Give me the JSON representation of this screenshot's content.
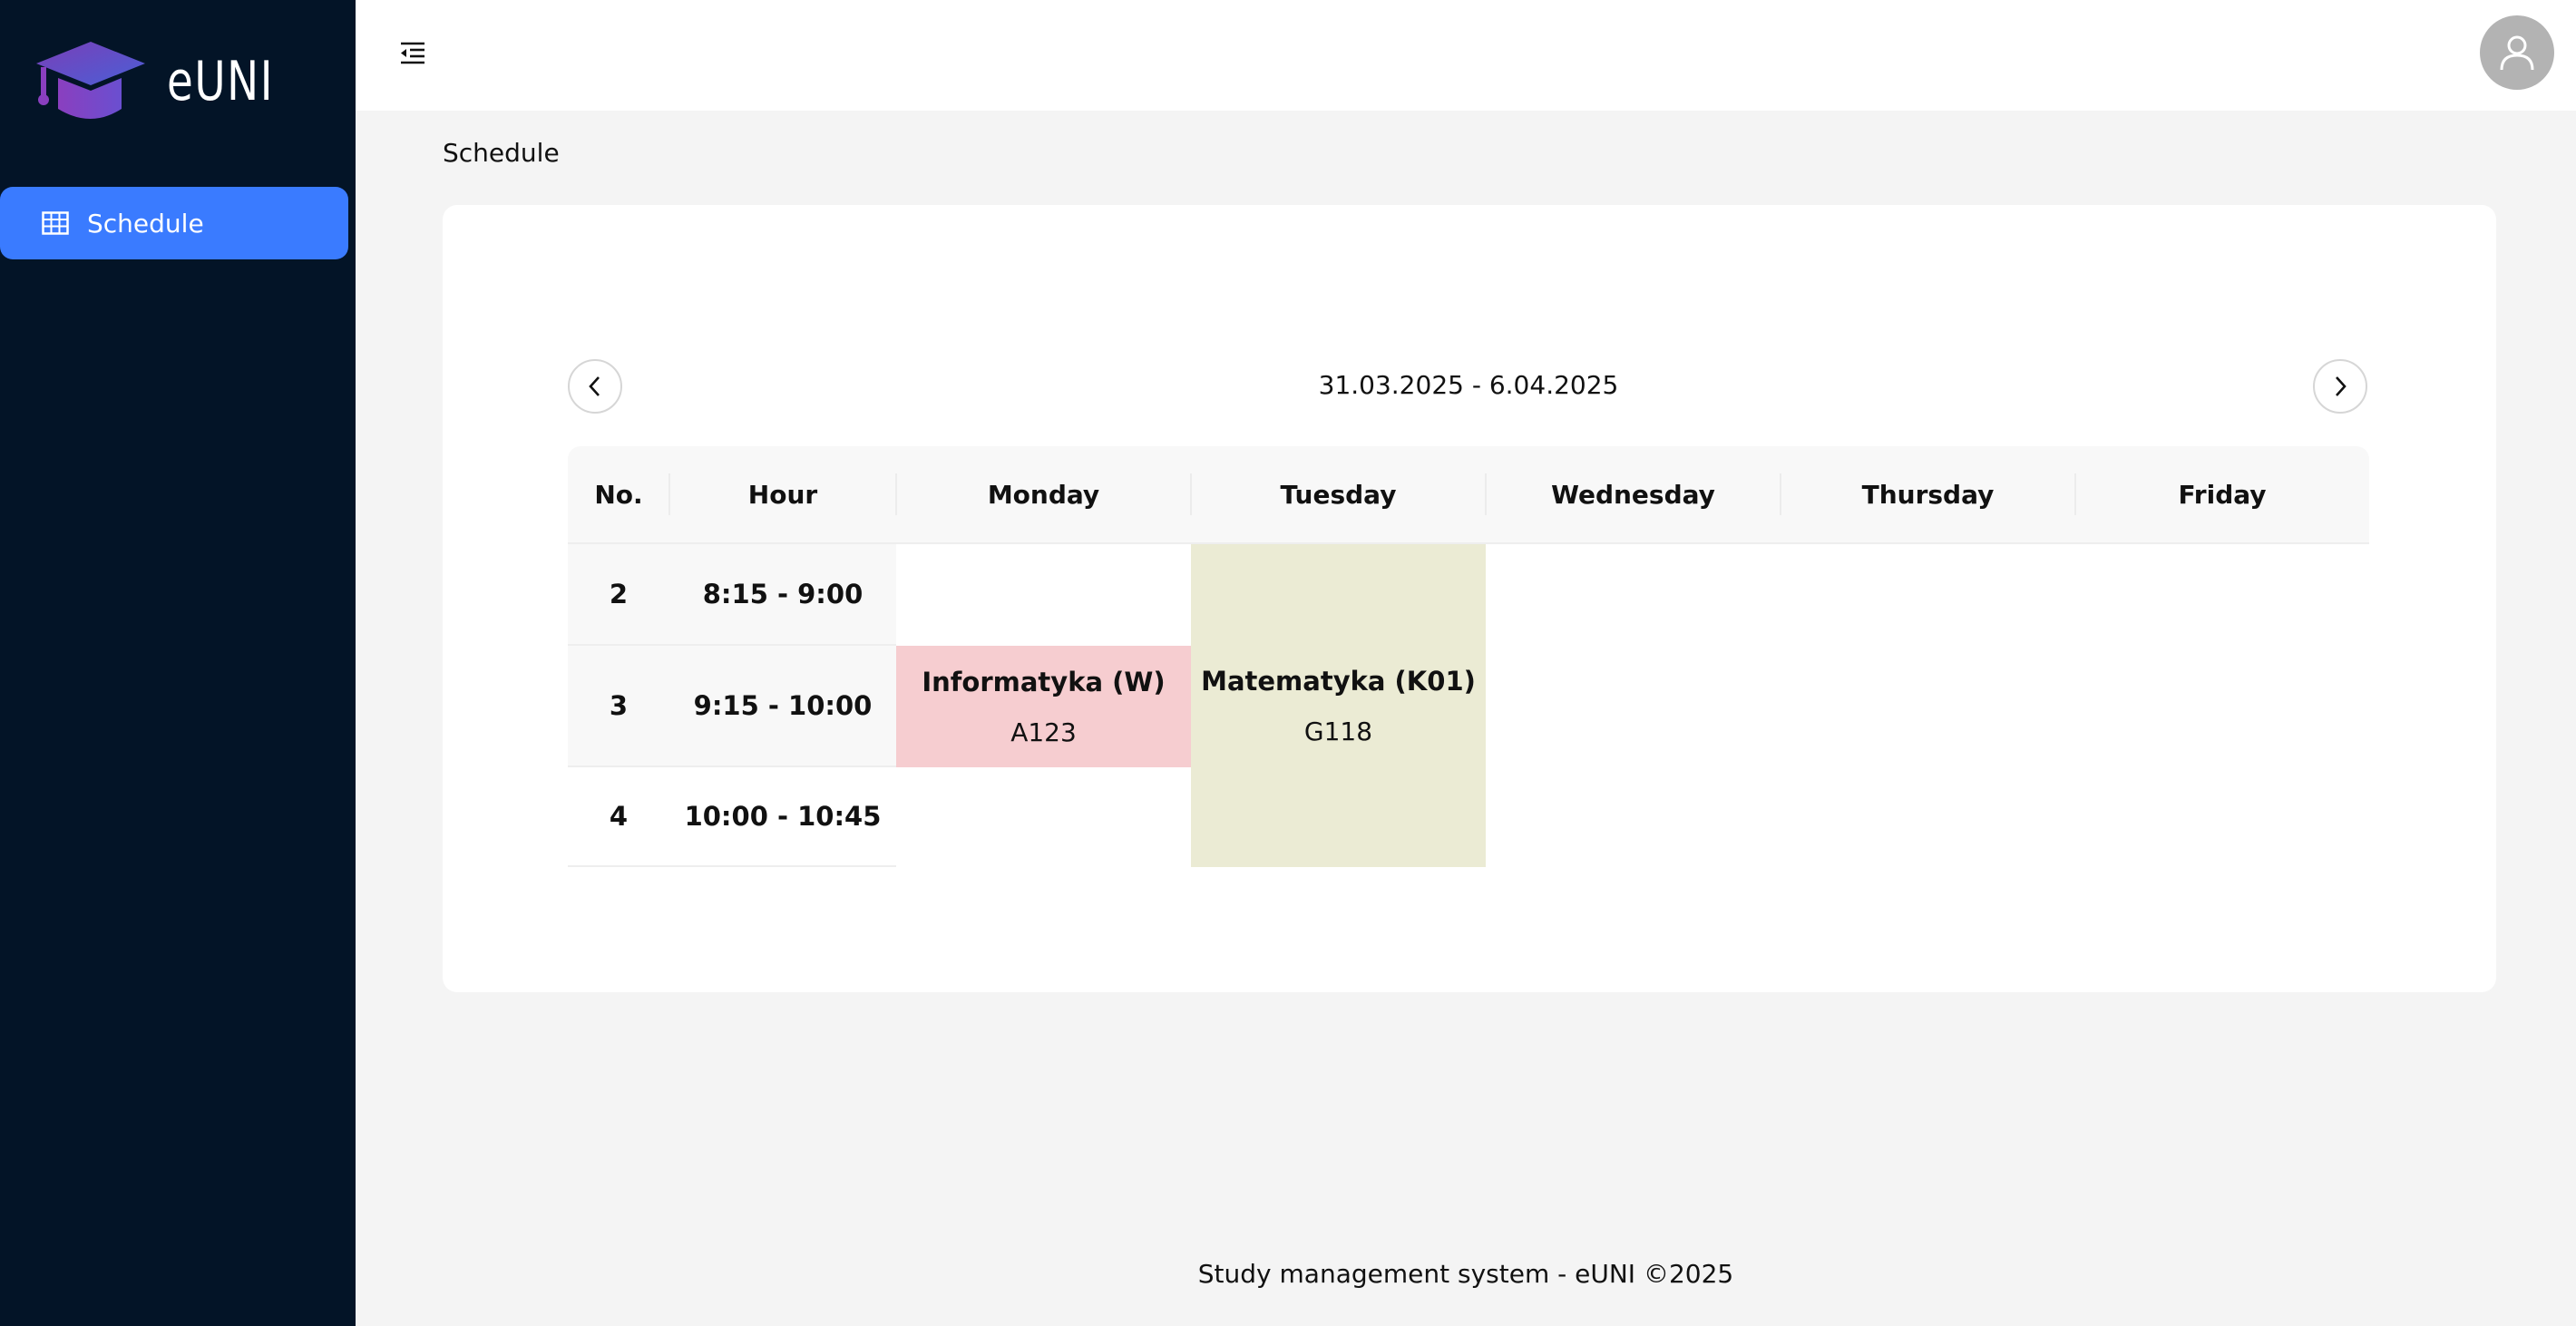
{
  "app": {
    "name": "eUNI"
  },
  "sidebar": {
    "items": [
      {
        "label": "Schedule",
        "icon": "table-icon",
        "active": true
      }
    ]
  },
  "header": {
    "collapse_icon": "menu-fold-icon",
    "avatar_icon": "user-icon"
  },
  "breadcrumb": "Schedule",
  "schedule": {
    "week_range": "31.03.2025 - 6.04.2025",
    "prev_icon": "chevron-left-icon",
    "next_icon": "chevron-right-icon",
    "columns": [
      "No.",
      "Hour",
      "Monday",
      "Tuesday",
      "Wednesday",
      "Thursday",
      "Friday"
    ],
    "rows": [
      {
        "no": "2",
        "hour": "8:15 - 9:00"
      },
      {
        "no": "3",
        "hour": "9:15 - 10:00"
      },
      {
        "no": "4",
        "hour": "10:00 - 10:45"
      }
    ],
    "events": [
      {
        "day": "Monday",
        "name": "Informatyka (W)",
        "room": "A123",
        "color": "#f6cdd0"
      },
      {
        "day": "Tuesday",
        "name": "Matematyka (K01)",
        "room": "G118",
        "color": "#ebebd4"
      }
    ]
  },
  "footer": "Study management system - eUNI ©2025",
  "colors": {
    "sidebar_bg": "#031427",
    "accent": "#3a7bff",
    "page_bg": "#f4f4f4"
  }
}
